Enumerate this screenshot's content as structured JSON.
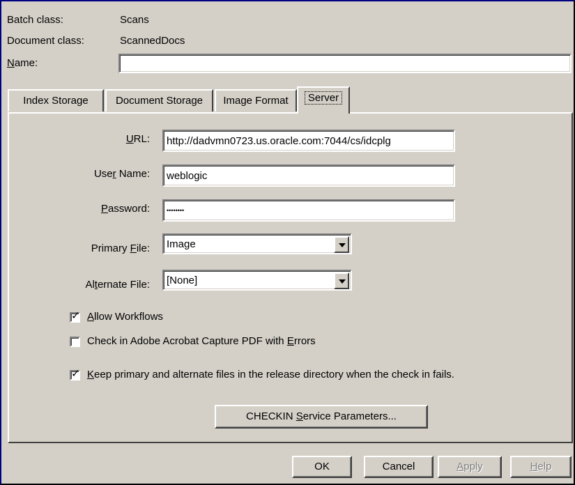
{
  "header": {
    "batch_class_label": "Batch class:",
    "batch_class_value": "Scans",
    "document_class_label": "Document class:",
    "document_class_value": "ScannedDocs",
    "name_label_hotkey": "N",
    "name_label_rest": "ame:",
    "name_value": ""
  },
  "tabs": [
    {
      "label": "Index Storage"
    },
    {
      "label": "Document Storage"
    },
    {
      "label": "Image Format"
    },
    {
      "label": "Server",
      "active": true
    }
  ],
  "server": {
    "url_label_hotkey": "U",
    "url_label_rest": "RL:",
    "url_value": "http://dadvmn0723.us.oracle.com:7044/cs/idcplg",
    "username_label_pre": "Use",
    "username_label_hotkey": "r",
    "username_label_rest": " Name:",
    "username_value": "weblogic",
    "password_label_hotkey": "P",
    "password_label_rest": "assword:",
    "password_value": "********",
    "primary_label_pre": "Primary ",
    "primary_label_hotkey": "F",
    "primary_label_rest": "ile:",
    "primary_value": "Image",
    "alternate_label_pre": "Al",
    "alternate_label_hotkey": "t",
    "alternate_label_rest": "ernate File:",
    "alternate_value": "[None]",
    "allow_workflows": {
      "checked": true,
      "hotkey": "A",
      "rest": "llow Workflows"
    },
    "check_in_pdf": {
      "checked": false,
      "pre": "Check in Adobe Acrobat Capture PDF with ",
      "hotkey": "E",
      "rest": "rrors"
    },
    "keep_files": {
      "checked": true,
      "hotkey": "K",
      "rest": "eep primary and alternate files in the release directory when the check in fails."
    },
    "checkin_params_pre": "CHECKIN ",
    "checkin_params_hotkey": "S",
    "checkin_params_rest": "ervice Parameters..."
  },
  "buttons": {
    "ok": "OK",
    "cancel": "Cancel",
    "apply_hotkey": "A",
    "apply_rest": "pply",
    "help_hotkey": "H",
    "help_rest": "elp"
  },
  "checkmark_glyph": "✓"
}
